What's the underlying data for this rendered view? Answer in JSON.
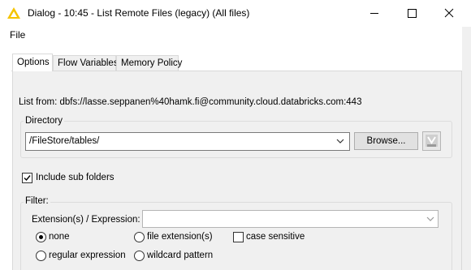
{
  "window": {
    "title": "Dialog - 10:45 - List Remote Files (legacy) (All files)",
    "icon": "warning-triangle-icon",
    "controls": [
      "minimize-icon",
      "maximize-icon",
      "close-icon"
    ]
  },
  "menu": {
    "items": [
      "File"
    ]
  },
  "tabs": [
    {
      "label": "Options",
      "active": true
    },
    {
      "label": "Flow Variables",
      "active": false
    },
    {
      "label": "Memory Policy",
      "active": false
    }
  ],
  "options": {
    "list_from": "List from: dbfs://lasse.seppanen%40hamk.fi@community.cloud.databricks.com:443",
    "directory": {
      "legend": "Directory",
      "value": "/FileStore/tables/",
      "browse_label": "Browse..."
    },
    "include_subfolders": {
      "label": "Include sub folders",
      "checked": true
    },
    "filter": {
      "legend": "Filter:",
      "ext_label": "Extension(s) / Expression:",
      "ext_value": "",
      "radios": [
        {
          "label": "none",
          "selected": true
        },
        {
          "label": "file extension(s)",
          "selected": false
        },
        {
          "label": "regular expression",
          "selected": false
        },
        {
          "label": "wildcard pattern",
          "selected": false
        }
      ],
      "case_sensitive": {
        "label": "case sensitive",
        "checked": false
      }
    }
  },
  "colors": {
    "accent_yellow": "#f5c400",
    "panel_bg": "#f0f0f0",
    "button_bg": "#e1e1e1"
  }
}
